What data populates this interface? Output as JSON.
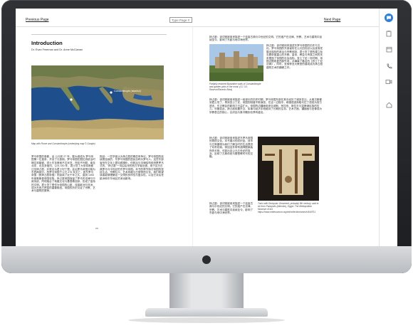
{
  "nav": {
    "previous": "Previous Page",
    "next": "Next Page",
    "page_input_placeholder": "Type Page #"
  },
  "article": {
    "title": "Introduction",
    "authors": "Dr. Evan Freeman and Dr. Anne McClanan",
    "map_caption": "Map with Rome and Constantinople (underlying map © Google)",
    "map_label": "Constantinople (Istanbul)",
    "page_number": "xx",
    "villa_caption": "Partially restored Byzantine walls of Constantinople and garden plots in the moat. (CC 3.0, Rasevic/Rasevic Bora)",
    "tunic_caption": "Tunic with Dionysiac Ornament, probably 5th century, said to be from Panopolis (Akhmim), Egypt. The Metropolitan Museum of Art, https://www.metmuseum.org/art/collection/search/444701",
    "left_col1": "罗马帝国的首都，由 公元前 27 年，屋大维成为 罗马帝国第一位皇帝，开创了元首制。罗马帝国在图拉真统治时期达到鼎盛，领土东至美索不达米亚，西至不列颠，南至北非，北至多瑙河。公元 330 年，君士坦丁大帝将首都迁至拜占庭，并更名为君士坦丁堡。此后罗马帝国分裂为东西两部分。西罗马帝国于公元 476 年灭亡，而东罗马帝国（即拜占庭帝国）则延续了近千年之久，直到 1453 年被奥斯曼帝国攻陷。拜占庭帝国保留了罗马的法律与行政传统，同时融合了希腊文化与基督教信仰，形成了独特的文明。君士坦丁堡作为帝国的心脏，连接欧洲与亚洲，成为东西方贸易的重要枢纽。帝国的历史见证了宗教、艺术与建筑的繁荣。",
    "left_col2": "拖延：一些学者认为拜占庭的概念有争议，罗马帝国的延续是连续的，东罗马帝国的居民自称为罗马人。这些东部省份在文化上更加希腊化，但政治与法律结构依然是罗马式的。“拜占庭”一词由后世的西方学者创造，用于区分古典罗马与中世纪的东罗马帝国。本书的章节探讨帝国的宫廷生活、宗教礼仪、艺术风格与日常物质文化。我们希望读者能够理解这一文明的多样性与复杂性，以及它对后世欧洲和中东地区的深远影响。",
    "right_col1": "拜占庭：该词常用来描述东罗马帝国的历史与文化。罗马帝国的东部省份在公元四世纪以后逐渐发展出独特的政治与宗教体制。君士坦丁堡的建立标志着帝国重心的东移。皇帝、教会与贵族之间的关系塑造了帝国的社会结构。查士丁尼一世时期，帝国试图收复西部失地，并编纂了著名的《查士丁尼法典》。同时，圣索菲亚大教堂的建成成为拜占庭建筑艺术的巅峰之作。",
    "right_col2": "拜占庭：该词常被用来描述一段漫长的历史时期，罗马帝国东部在其中经历了诸多变迁。从奥古斯都到君士坦丁，再到查士丁尼，帝国的制度不断演变。在这一过程中，希腊语逐渐取代拉丁语成为官方语言，东正教会的影响力日益扩大。帝国的边疆面临来自波斯、阿拉伯、斯拉夫与突厥诸民族的压力。尽管如此，拜占庭依靠外交、军事与经济手段维持了长期的生存。艺术方面，镶嵌画与圣像成为宗教表达的核心，丝织品与象牙雕刻也享有盛名。",
    "right_col3": "拜占庭：该词常被用来描述东罗马帝国的物质文化。本书展示的纺织品、钱币与日常器物为我们了解当时的生活提供了珍贵线索。例如这件带有酒神图案装饰的长袍，可能出自公元五世纪的埃及，反映了古典传统与基督教时代的交融。",
    "right_col4": "拜占庭：该词常被用来描述一个连接古典与中世纪的文明。它的遗产在法律、宗教、艺术与建筑中延续至今，影响了东欧与地中海世界。"
  },
  "rail": {
    "icons": [
      "chat-icon",
      "notes-icon",
      "calendar-icon",
      "phone-icon",
      "video-icon",
      "home-icon"
    ]
  },
  "colors": {
    "accent": "#2c7fe0",
    "bezel": "#2a2b2e"
  }
}
